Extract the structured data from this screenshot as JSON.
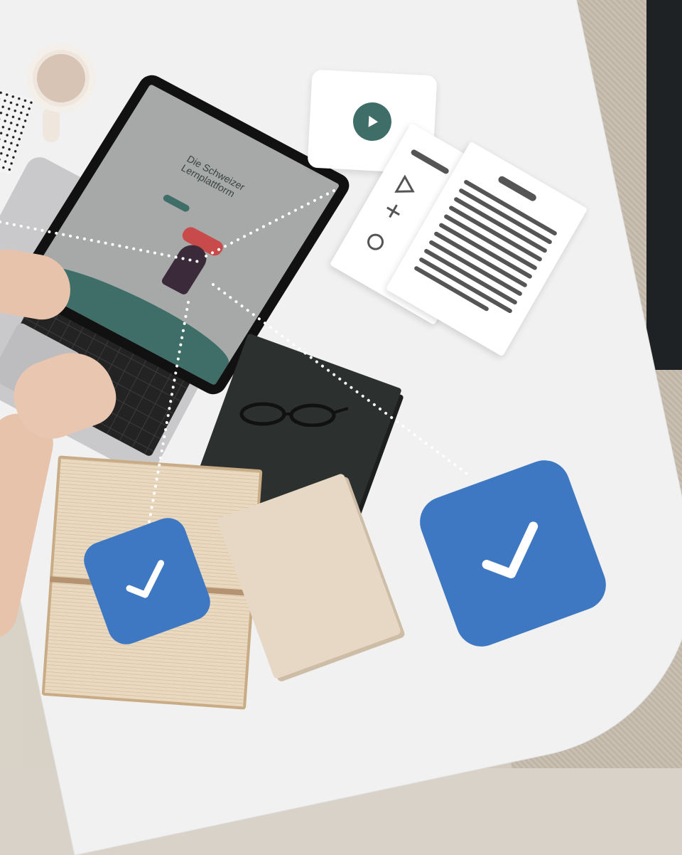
{
  "screen": {
    "logo": "",
    "headline": "Die Schweizer Lernplattform"
  },
  "icons": {
    "video": "play-icon",
    "document": "document-icon",
    "check": "checkmark-icon"
  },
  "colors": {
    "teal": "#3f6e69",
    "blue": "#3f78c2",
    "table": "#f1f1f1"
  }
}
